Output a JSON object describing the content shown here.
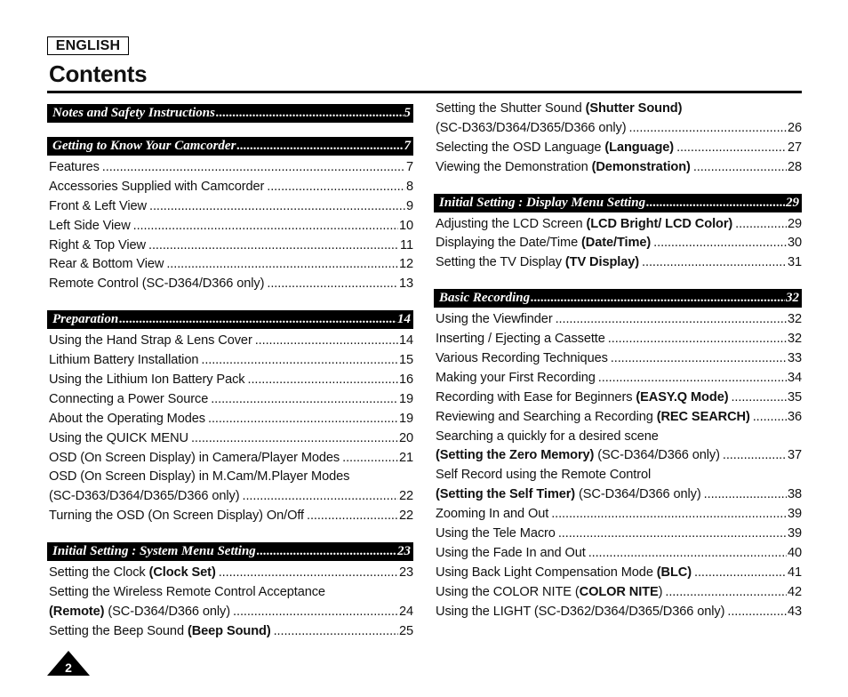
{
  "header": {
    "language": "ENGLISH",
    "title": "Contents"
  },
  "left_column": [
    {
      "type": "section",
      "title": "Notes and Safety Instructions",
      "page": "5",
      "entries": []
    },
    {
      "type": "section",
      "title": "Getting to Know Your Camcorder",
      "page": "7",
      "entries": [
        {
          "text": "Features",
          "bold": "",
          "after": "",
          "page": "7"
        },
        {
          "text": "Accessories Supplied with Camcorder",
          "bold": "",
          "after": "",
          "page": "8"
        },
        {
          "text": "Front & Left View",
          "bold": "",
          "after": "",
          "page": "9"
        },
        {
          "text": "Left Side View",
          "bold": "",
          "after": "",
          "page": "10"
        },
        {
          "text": "Right & Top View",
          "bold": "",
          "after": "",
          "page": "11"
        },
        {
          "text": "Rear & Bottom View",
          "bold": "",
          "after": "",
          "page": "12"
        },
        {
          "text": "Remote Control (SC-D364/D366 only)",
          "bold": "",
          "after": "",
          "page": "13"
        }
      ]
    },
    {
      "type": "section",
      "title": "Preparation",
      "page": "14",
      "entries": [
        {
          "text": "Using the Hand Strap & Lens Cover",
          "bold": "",
          "after": "",
          "page": "14"
        },
        {
          "text": "Lithium Battery Installation",
          "bold": "",
          "after": "",
          "page": "15"
        },
        {
          "text": "Using the Lithium Ion Battery Pack",
          "bold": "",
          "after": "",
          "page": "16"
        },
        {
          "text": "Connecting a Power Source",
          "bold": "",
          "after": "",
          "page": "19"
        },
        {
          "text": "About the Operating Modes",
          "bold": "",
          "after": "",
          "page": "19"
        },
        {
          "text": "Using the QUICK MENU",
          "bold": "",
          "after": "",
          "page": "20"
        },
        {
          "text": "OSD (On Screen Display) in Camera/Player Modes",
          "bold": "",
          "after": "",
          "page": "21"
        },
        {
          "text": "OSD (On Screen Display) in M.Cam/M.Player Modes",
          "bold": "",
          "after": "",
          "page": ""
        },
        {
          "text": "(SC-D363/D364/D365/D366 only)",
          "bold": "",
          "after": "",
          "page": "22"
        },
        {
          "text": "Turning the OSD (On Screen Display) On/Off",
          "bold": "",
          "after": "",
          "page": "22"
        }
      ]
    },
    {
      "type": "section",
      "title": "Initial Setting : System Menu Setting",
      "page": "23",
      "entries": [
        {
          "text": "Setting the Clock ",
          "bold": "(Clock Set)",
          "after": "",
          "page": "23"
        },
        {
          "text": "Setting the Wireless Remote Control Acceptance",
          "bold": "",
          "after": "",
          "page": ""
        },
        {
          "text": "",
          "bold": "(Remote)",
          "after": " (SC-D364/D366 only)",
          "page": "24"
        },
        {
          "text": "Setting the Beep Sound ",
          "bold": "(Beep Sound)",
          "after": "",
          "page": "25"
        }
      ]
    }
  ],
  "right_column_top": [
    {
      "text": "Setting the Shutter Sound ",
      "bold": "(Shutter Sound)",
      "after": "",
      "page": ""
    },
    {
      "text": "(SC-D363/D364/D365/D366 only)",
      "bold": "",
      "after": "",
      "page": "26"
    },
    {
      "text": "Selecting the OSD Language ",
      "bold": "(Language)",
      "after": "",
      "page": "27"
    },
    {
      "text": "Viewing the Demonstration ",
      "bold": "(Demonstration)",
      "after": "",
      "page": "28"
    }
  ],
  "right_column": [
    {
      "type": "section",
      "title": "Initial Setting : Display Menu Setting",
      "page": "29",
      "entries": [
        {
          "text": "Adjusting the LCD Screen ",
          "bold": "(LCD Bright/ LCD Color)",
          "after": "",
          "page": "29"
        },
        {
          "text": "Displaying the Date/Time ",
          "bold": "(Date/Time)",
          "after": "",
          "page": "30"
        },
        {
          "text": "Setting the TV Display ",
          "bold": "(TV Display)",
          "after": "",
          "page": "31"
        }
      ]
    },
    {
      "type": "section",
      "title": "Basic Recording",
      "page": "32",
      "entries": [
        {
          "text": "Using the Viewfinder",
          "bold": "",
          "after": "",
          "page": "32"
        },
        {
          "text": "Inserting / Ejecting a Cassette",
          "bold": "",
          "after": "",
          "page": "32"
        },
        {
          "text": "Various Recording Techniques",
          "bold": "",
          "after": "",
          "page": "33"
        },
        {
          "text": "Making your First Recording",
          "bold": "",
          "after": "",
          "page": "34"
        },
        {
          "text": "Recording with Ease for Beginners ",
          "bold": "(EASY.Q Mode)",
          "after": "",
          "page": "35"
        },
        {
          "text": "Reviewing and Searching a Recording ",
          "bold": "(REC SEARCH)",
          "after": "",
          "page": "36"
        },
        {
          "text": "Searching a quickly for a desired scene",
          "bold": "",
          "after": "",
          "page": ""
        },
        {
          "text": "",
          "bold": "(Setting the Zero Memory)",
          "after": " (SC-D364/D366 only)",
          "page": "37"
        },
        {
          "text": "Self Record using the Remote Control",
          "bold": "",
          "after": "",
          "page": ""
        },
        {
          "text": "",
          "bold": "(Setting the Self Timer)",
          "after": " (SC-D364/D366 only)",
          "page": "38"
        },
        {
          "text": "Zooming In and Out",
          "bold": "",
          "after": "",
          "page": "39"
        },
        {
          "text": "Using the Tele Macro",
          "bold": "",
          "after": "",
          "page": "39"
        },
        {
          "text": "Using the Fade In and Out",
          "bold": "",
          "after": "",
          "page": "40"
        },
        {
          "text": "Using Back Light Compensation Mode ",
          "bold": "(BLC)",
          "after": "",
          "page": "41"
        },
        {
          "text": "Using the COLOR NITE (",
          "bold": "COLOR NITE",
          "after": ")",
          "page": "42"
        },
        {
          "text": "Using the LIGHT (SC-D362/D364/D365/D366 only)",
          "bold": "",
          "after": "",
          "page": "43"
        }
      ]
    }
  ],
  "footer": {
    "page_number": "2"
  }
}
